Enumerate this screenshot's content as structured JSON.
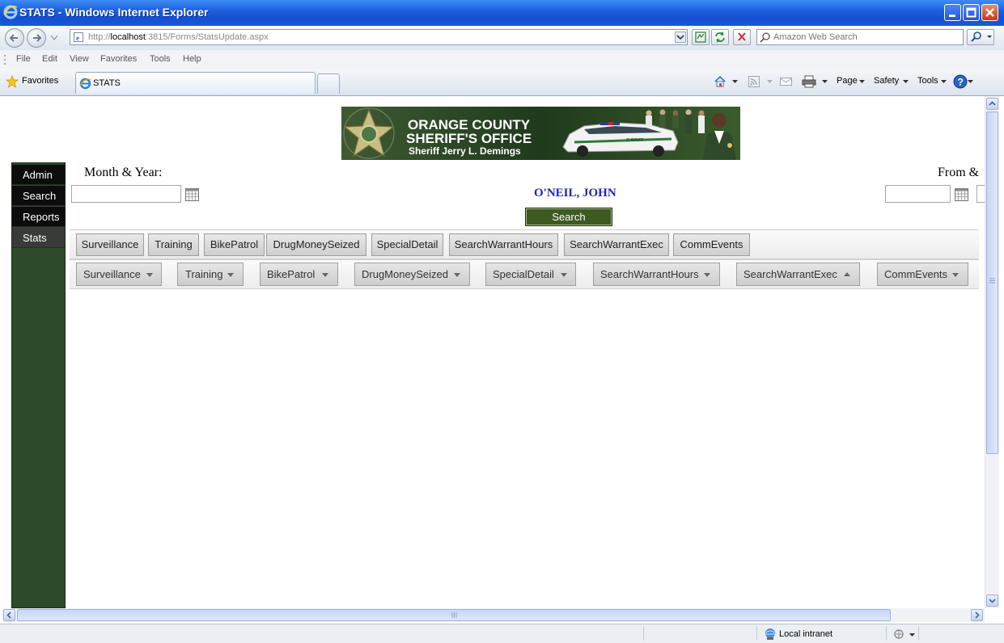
{
  "window": {
    "title": "STATS - Windows Internet Explorer"
  },
  "address": {
    "url_prefix": "http://",
    "url_host": "localhost",
    "url_rest": ":3815/Forms/StatsUpdate.aspx",
    "search_placeholder": "Amazon Web Search"
  },
  "menu": [
    "File",
    "Edit",
    "View",
    "Favorites",
    "Tools",
    "Help"
  ],
  "favbar": {
    "favorites_label": "Favorites",
    "tab_title": "STATS",
    "page_label": "Page",
    "safety_label": "Safety",
    "tools_label": "Tools"
  },
  "banner": {
    "line1": "ORANGE COUNTY",
    "line2": "SHERIFF'S OFFICE",
    "line3": "Sheriff Jerry L. Demings",
    "car_text": "SHERIFF"
  },
  "sidebar": {
    "items": [
      "Admin",
      "Search",
      "Reports",
      "Stats"
    ],
    "active": "Stats"
  },
  "form": {
    "month_year_label": "Month & Year:",
    "from_label": "From &",
    "officer_name": "O'NEIL, JOHN",
    "search_button": "Search"
  },
  "tabs": [
    "Surveillance",
    "Training",
    "BikePatrol",
    "DrugMoneySeized",
    "SpecialDetail",
    "SearchWarrantHours",
    "SearchWarrantExec",
    "CommEvents"
  ],
  "dropdowns": [
    {
      "label": "Surveillance",
      "arrow": "down"
    },
    {
      "label": "Training",
      "arrow": "down"
    },
    {
      "label": "BikePatrol",
      "arrow": "down"
    },
    {
      "label": "DrugMoneySeized",
      "arrow": "down"
    },
    {
      "label": "SpecialDetail",
      "arrow": "down"
    },
    {
      "label": "SearchWarrantHours",
      "arrow": "down"
    },
    {
      "label": "SearchWarrantExec",
      "arrow": "up"
    },
    {
      "label": "CommEvents",
      "arrow": "down"
    }
  ],
  "status": {
    "zone": "Local intranet"
  },
  "colors": {
    "sidebar_green": "#2d4a2a",
    "search_button_green": "#3d5a21",
    "officer_blue": "#2323b5",
    "titlebar_blue": "#1450d2"
  }
}
